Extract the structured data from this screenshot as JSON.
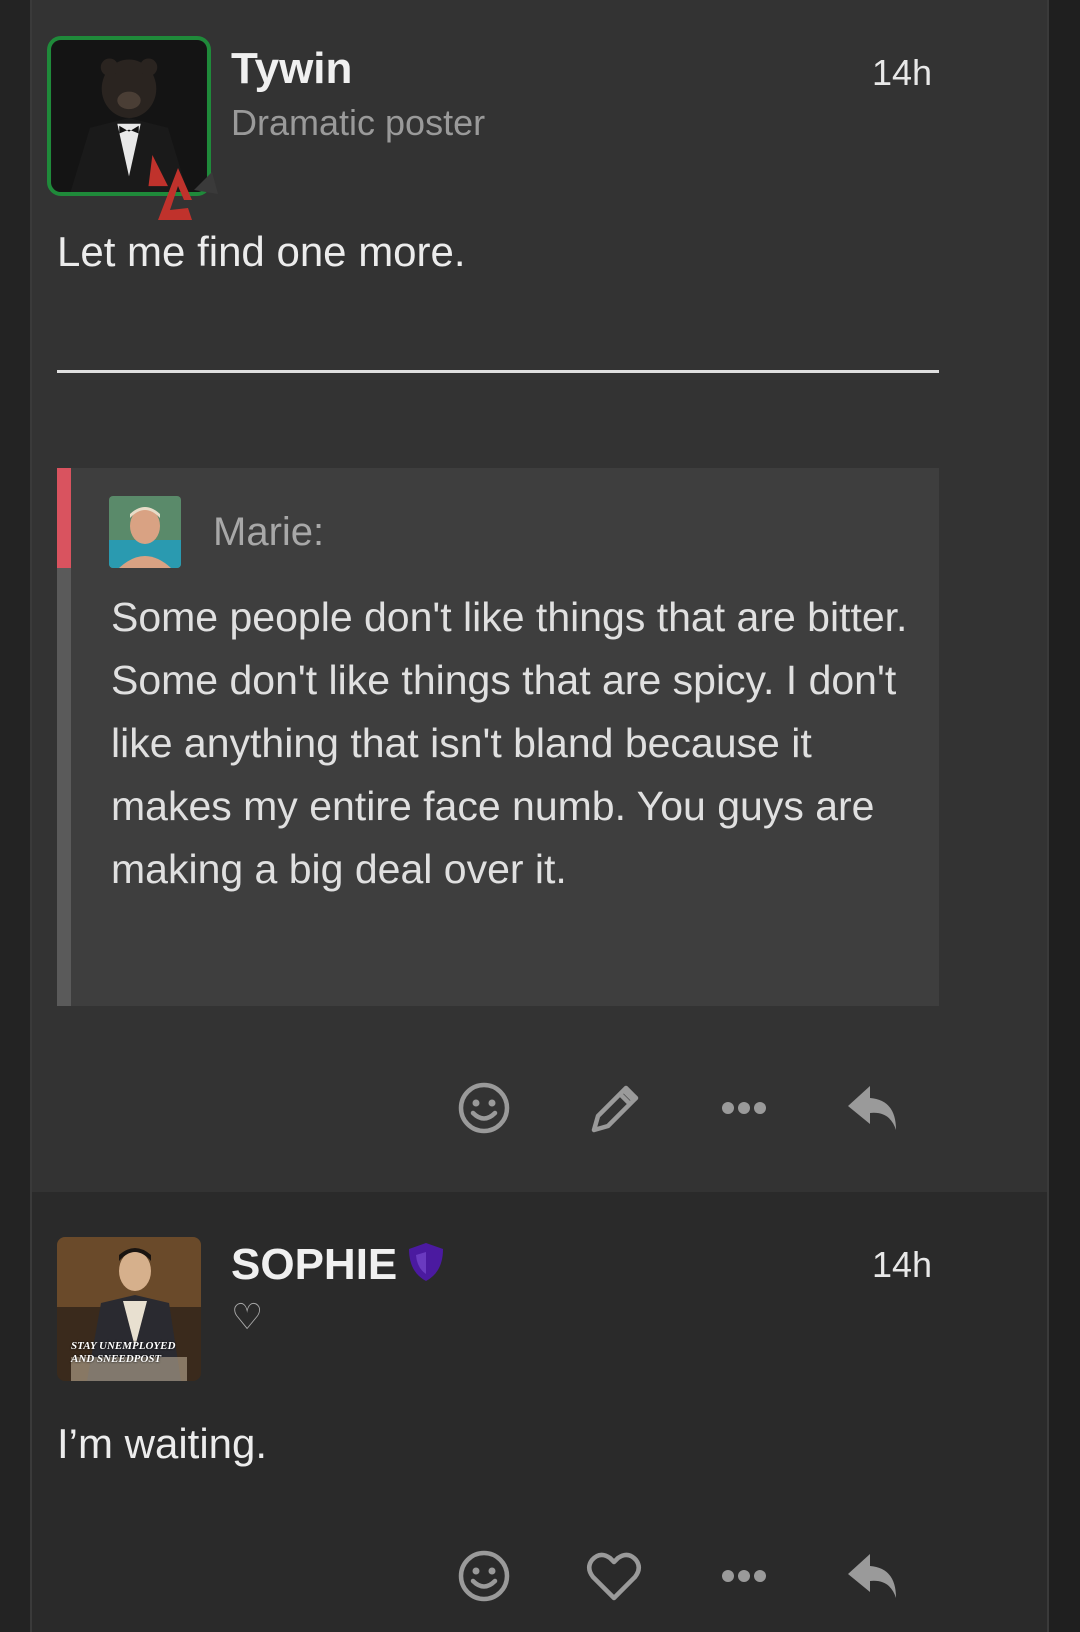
{
  "posts": [
    {
      "username": "Tywin",
      "subtitle": "Dramatic poster",
      "time": "14h",
      "body": "Let me find one more.",
      "quote": {
        "author": "Marie:",
        "text": "Some people don't like things that are bitter. Some don't like things that are spicy. I don't like anything that isn't bland because it makes my entire face numb. You guys are making a big deal over it."
      },
      "actions": [
        "smile-icon",
        "pencil-icon",
        "more-icon",
        "reply-icon"
      ]
    },
    {
      "username": "SOPHIE",
      "subtitle": "♡",
      "time": "14h",
      "body": "I’m waiting.",
      "avatar_caption": "STAY UNEMPLOYED AND SNEEDPOST",
      "actions": [
        "smile-icon",
        "heart-icon",
        "more-icon",
        "reply-icon"
      ]
    }
  ],
  "colors": {
    "post_bg": "#333333",
    "quote_bar": "#d9535f",
    "avatar_ring": "#1f8a3a",
    "badge": "#4b1aa0"
  }
}
